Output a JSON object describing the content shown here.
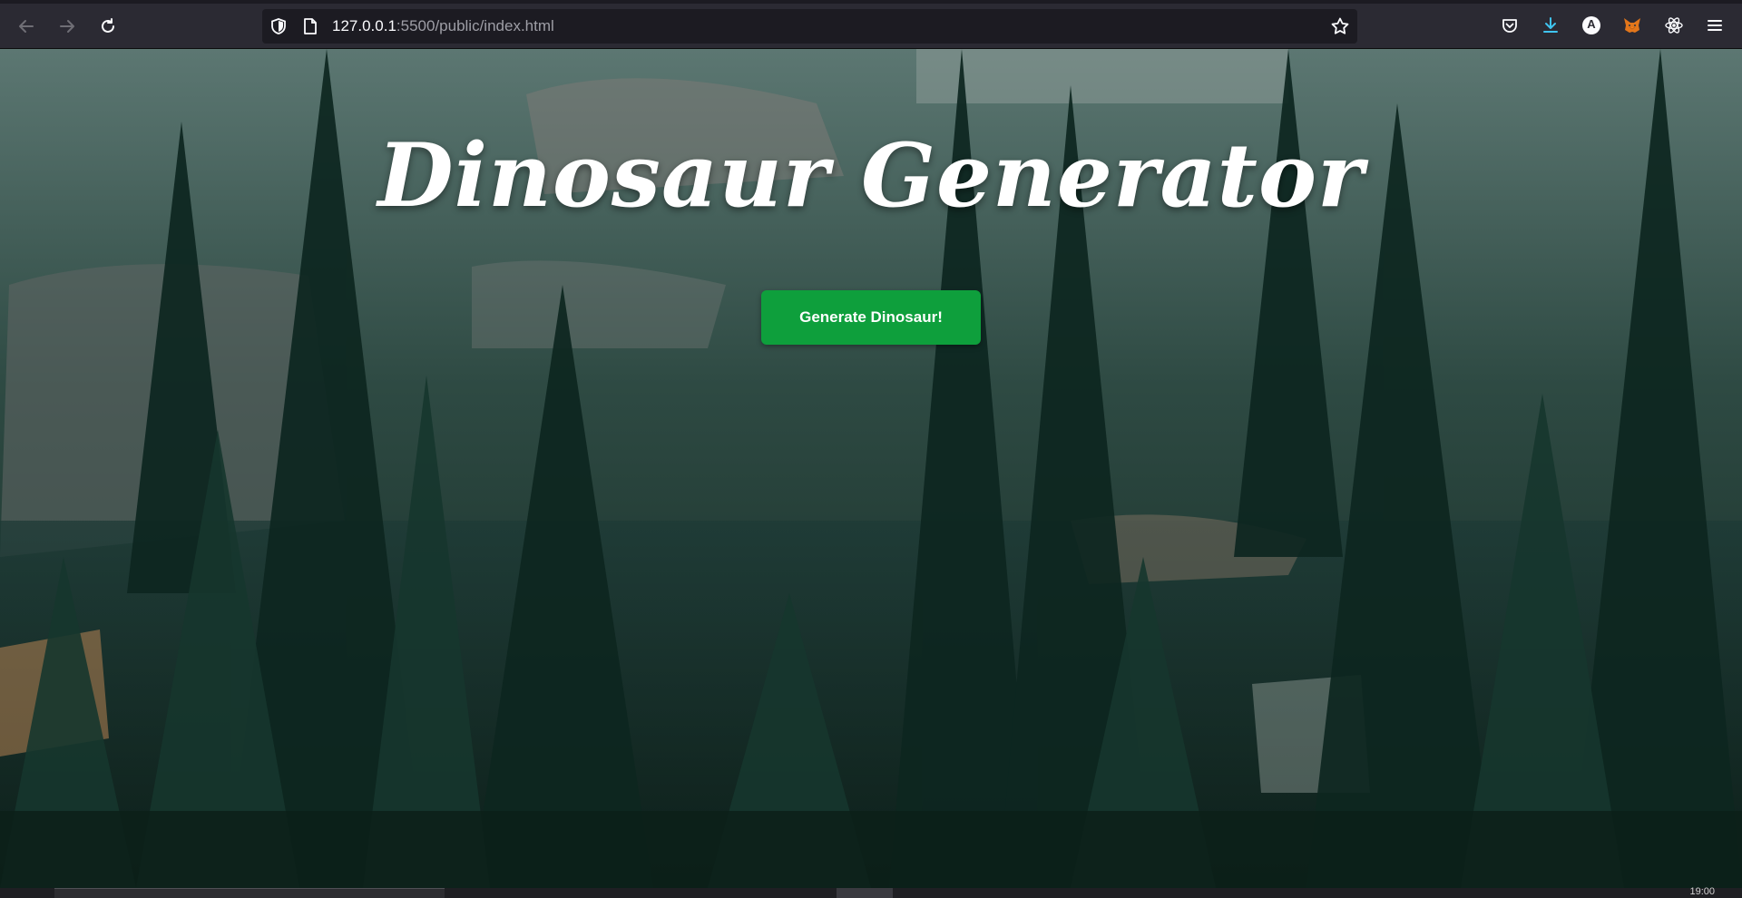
{
  "browser": {
    "url_host": "127.0.0.1",
    "url_path": ":5500/public/index.html",
    "icons": {
      "back": "arrow-left-icon",
      "forward": "arrow-right-icon",
      "reload": "reload-icon",
      "tracking": "shield-icon",
      "page": "page-icon",
      "bookmark": "star-icon",
      "pocket": "pocket-icon",
      "downloads": "download-icon",
      "account": "account-icon",
      "extension_fox": "metamask-icon",
      "extension_react": "react-icon",
      "menu": "hamburger-menu-icon"
    },
    "account_letter": "A"
  },
  "page": {
    "title": "Dinosaur Generator",
    "button_label": "Generate Dinosaur!",
    "button_color": "#0e9f3c"
  },
  "taskbar": {
    "clock": "19:00"
  }
}
